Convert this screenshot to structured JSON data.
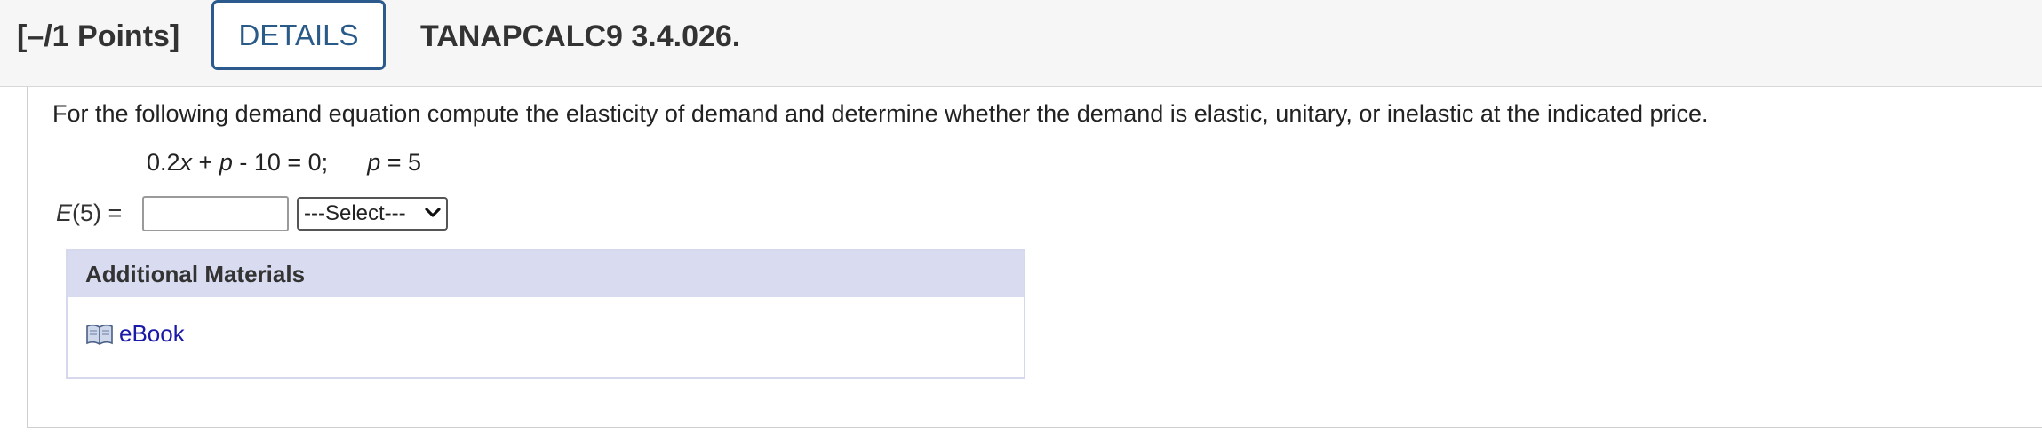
{
  "header": {
    "points": "[–/1 Points]",
    "details_label": "DETAILS",
    "question_id": "TANAPCALC9 3.4.026."
  },
  "question": {
    "prompt": "For the following demand equation compute the elasticity of demand and determine whether the demand is elastic, unitary, or inelastic at the indicated price.",
    "equation": {
      "coef": "0.2",
      "x": "x",
      "plus": " + ",
      "p": "p",
      "rest": " - 10 = 0;",
      "p2": "p",
      "price": " = 5"
    },
    "answer": {
      "label_fn": "E",
      "label_arg": "(5) =",
      "input_value": "",
      "select_value": "---Select---"
    }
  },
  "materials": {
    "title": "Additional Materials",
    "ebook_label": "eBook"
  },
  "icons": {
    "book": "open-book-icon",
    "chevron": "chevron-down-icon"
  }
}
